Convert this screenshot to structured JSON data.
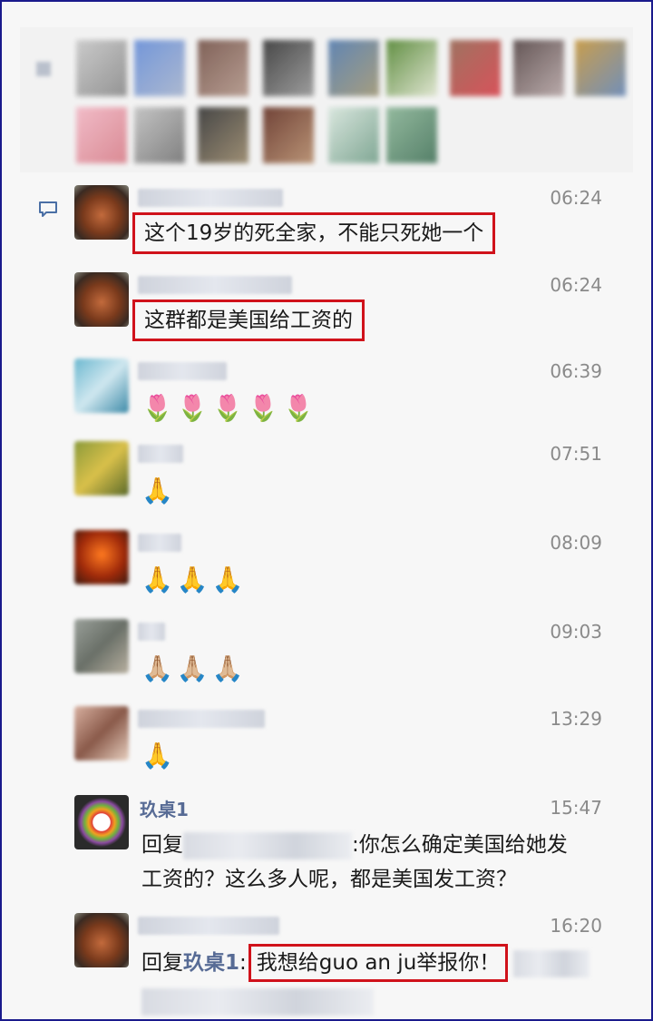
{
  "messages": [
    {
      "time": "06:24",
      "text": "这个19岁的死全家，不能只死她一个"
    },
    {
      "time": "06:24",
      "text": "这群都是美国给工资的"
    },
    {
      "time": "06:39",
      "text": "🌷🌷🌷🌷🌷"
    },
    {
      "time": "07:51",
      "text": "🙏"
    },
    {
      "time": "08:09",
      "text": "🙏🙏🙏"
    },
    {
      "time": "09:03",
      "text": "🙏🏼🙏🏼🙏🏼"
    },
    {
      "time": "13:29",
      "text": "🙏"
    },
    {
      "name": "玖桌1",
      "time": "15:47",
      "reply_prefix": "回复",
      "reply_line1_end": ":你怎么确定美国给她发",
      "reply_line2": "工资的？这么多人呢，都是美国发工资？"
    },
    {
      "time": "16:20",
      "reply_prefix": "回复",
      "reply_to": "玖桌1",
      "reply_colon": ":",
      "reply_text": "我想给guo an ju举报你！"
    }
  ],
  "colors": {
    "highlight_border": "#d0121b",
    "name_blue": "#576b95",
    "time_gray": "#8a8a8a",
    "frame_border": "#1a1a8c"
  },
  "icons": {
    "chat": "chat-bubble-icon"
  }
}
